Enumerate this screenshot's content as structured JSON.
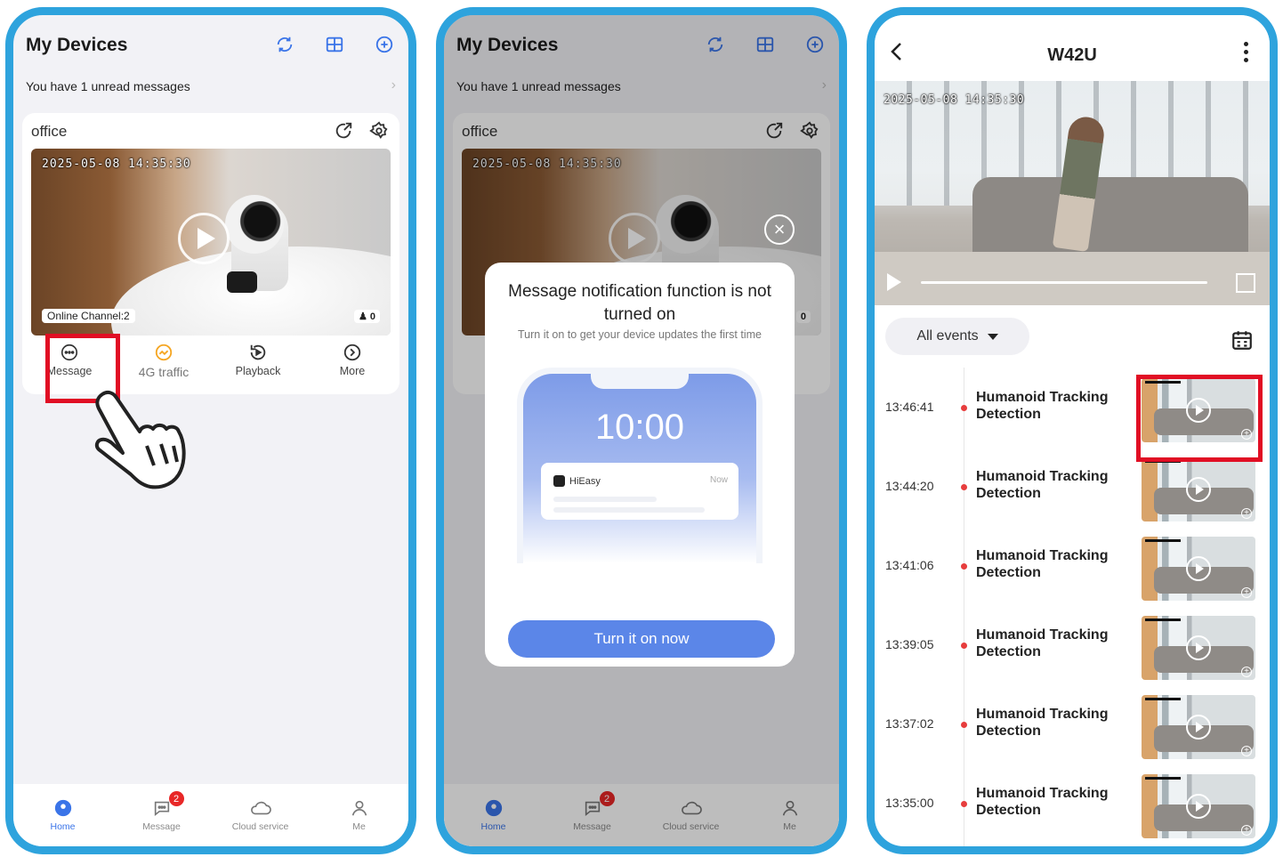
{
  "home": {
    "title": "My Devices",
    "unread": "You have 1 unread messages",
    "device": {
      "name": "office",
      "timestamp": "2025-05-08 14:35:30",
      "online": "Online Channel:2",
      "viewers": "0"
    },
    "actions": [
      {
        "label": "Message"
      },
      {
        "label": "4G traffic"
      },
      {
        "label": "Playback"
      },
      {
        "label": "More"
      }
    ]
  },
  "tabbar": {
    "tabs": [
      {
        "label": "Home"
      },
      {
        "label": "Message",
        "badge": "2"
      },
      {
        "label": "Cloud service"
      },
      {
        "label": "Me"
      }
    ]
  },
  "modal": {
    "title": "Message notification function is not turned on",
    "subtitle": "Turn it on to get your device updates the first time",
    "mock_time": "10:00",
    "mock_app": "HiEasy",
    "mock_now": "Now",
    "button": "Turn it on now"
  },
  "events_page": {
    "title": "W42U",
    "timestamp": "2025-05-08 14:35:30",
    "filter": "All events",
    "events": [
      {
        "time": "13:46:41",
        "title": "Humanoid Tracking Detection"
      },
      {
        "time": "13:44:20",
        "title": "Humanoid Tracking Detection"
      },
      {
        "time": "13:41:06",
        "title": "Humanoid Tracking Detection"
      },
      {
        "time": "13:39:05",
        "title": "Humanoid Tracking Detection"
      },
      {
        "time": "13:37:02",
        "title": "Humanoid Tracking Detection"
      },
      {
        "time": "13:35:00",
        "title": "Humanoid Tracking Detection"
      }
    ]
  },
  "colors": {
    "frame": "#2ea3dd",
    "highlight": "#e10e24",
    "accent": "#5b86e8",
    "badge": "#e82727",
    "orange": "#f5a623"
  }
}
